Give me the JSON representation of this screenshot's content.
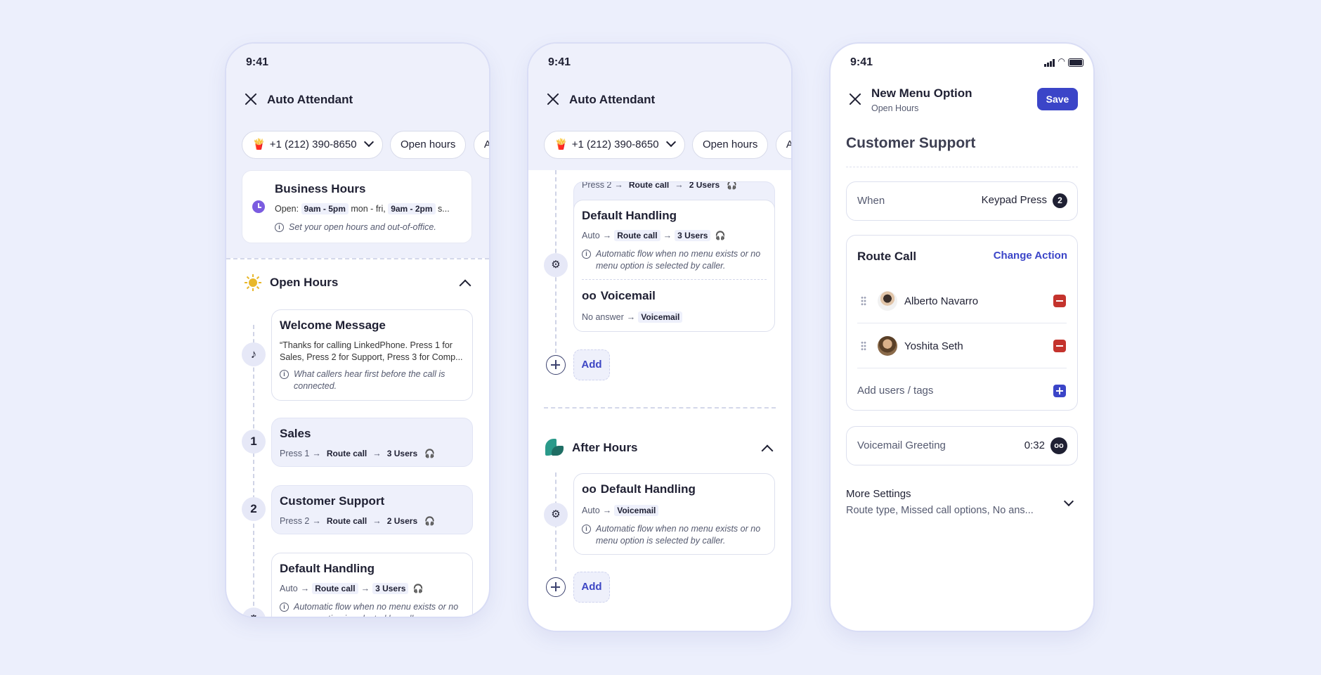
{
  "phone1": {
    "time": "9:41",
    "title": "Auto Attendant",
    "chips": {
      "phone": "+1 (212) 390-8650",
      "open_hours": "Open hours",
      "after": "A"
    },
    "business": {
      "title": "Business Hours",
      "open_label": "Open:",
      "slot1": "9am - 5pm",
      "days1": "mon - fri,",
      "slot2": "9am - 2pm",
      "days2": "s...",
      "info": "Set your open hours and out-of-office."
    },
    "open_hours_title": "Open Hours",
    "welcome": {
      "title": "Welcome Message",
      "text": "“Thanks for calling LinkedPhone. Press 1 for Sales, Press 2 for Support, Press 3 for Comp...",
      "info": "What callers hear first before the call is connected."
    },
    "sales": {
      "num": "1",
      "title": "Sales",
      "press": "Press 1",
      "action": "Route call",
      "users": "3 Users"
    },
    "support": {
      "num": "2",
      "title": "Customer Support",
      "press": "Press 2",
      "action": "Route call",
      "users": "2 Users"
    },
    "default": {
      "title": "Default Handling",
      "auto": "Auto",
      "action": "Route call",
      "users": "3 Users",
      "info": "Automatic flow when no menu exists or no menu option is selected by caller."
    }
  },
  "phone2": {
    "time": "9:41",
    "title": "Auto Attendant",
    "chips": {
      "phone": "+1 (212) 390-8650",
      "open_hours": "Open hours",
      "after": "A"
    },
    "cut_card": {
      "press": "Press 2",
      "action": "Route call",
      "users": "2 Users"
    },
    "default": {
      "title": "Default Handling",
      "auto": "Auto",
      "action": "Route call",
      "users": "3 Users",
      "info": "Automatic flow when no menu exists or no menu option is selected by caller."
    },
    "voicemail": {
      "title": "Voicemail",
      "cond": "No answer",
      "action": "Voicemail"
    },
    "add_label": "Add",
    "after_hours_title": "After Hours",
    "after_default": {
      "title": "Default Handling",
      "auto": "Auto",
      "action": "Voicemail",
      "info": "Automatic flow when no menu exists or no menu option is selected by caller."
    },
    "add_label2": "Add"
  },
  "phone3": {
    "time": "9:41",
    "title": "New Menu Option",
    "subtitle": "Open Hours",
    "save": "Save",
    "section": "Customer Support",
    "when_label": "When",
    "when_value": "Keypad Press",
    "when_num": "2",
    "route_title": "Route Call",
    "change_action": "Change Action",
    "users": [
      {
        "name": "Alberto Navarro"
      },
      {
        "name": "Yoshita Seth"
      }
    ],
    "add_users": "Add users / tags",
    "vm_label": "Voicemail Greeting",
    "vm_duration": "0:32",
    "more_title": "More Settings",
    "more_sub": "Route type, Missed call options, No ans..."
  },
  "colors": {
    "accent": "#3b45c8",
    "remove": "#c4332d",
    "band": "#eef0fb"
  }
}
